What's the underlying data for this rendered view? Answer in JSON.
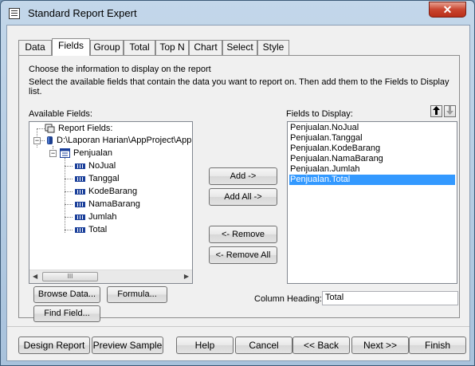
{
  "window": {
    "title": "Standard Report Expert",
    "close_glyph": "✕"
  },
  "tabs": [
    "Data",
    "Fields",
    "Group",
    "Total",
    "Top N",
    "Chart",
    "Select",
    "Style"
  ],
  "active_tab": "Fields",
  "instructions": {
    "line1": "Choose the information to display on the report",
    "line2": "Select the available fields that contain the data you want to report on.  Then add them to the Fields to Display list."
  },
  "available": {
    "label": "Available Fields:",
    "tree": {
      "report_fields": "Report Fields:",
      "database": "D:\\Laporan Harian\\AppProject\\App",
      "table": "Penjualan",
      "fields": [
        "NoJual",
        "Tanggal",
        "KodeBarang",
        "NamaBarang",
        "Jumlah",
        "Total"
      ]
    },
    "scroll_thumb": "III"
  },
  "buttons": {
    "add": "Add ->",
    "add_all": "Add All ->",
    "remove": "<- Remove",
    "remove_all": "<- Remove All",
    "browse": "Browse Data...",
    "formula": "Formula...",
    "find": "Find Field..."
  },
  "display": {
    "label": "Fields to Display:",
    "items": [
      "Penjualan.NoJual",
      "Penjualan.Tanggal",
      "Penjualan.KodeBarang",
      "Penjualan.NamaBarang",
      "Penjualan.Jumlah",
      "Penjualan.Total"
    ],
    "selected": "Penjualan.Total",
    "up_glyph": "🡅",
    "down_glyph": "🡇"
  },
  "column_heading": {
    "label": "Column Heading:",
    "value": "Total"
  },
  "footer": [
    "Design Report",
    "Preview Sample",
    "Help",
    "Cancel",
    "<< Back",
    "Next >>",
    "Finish"
  ]
}
